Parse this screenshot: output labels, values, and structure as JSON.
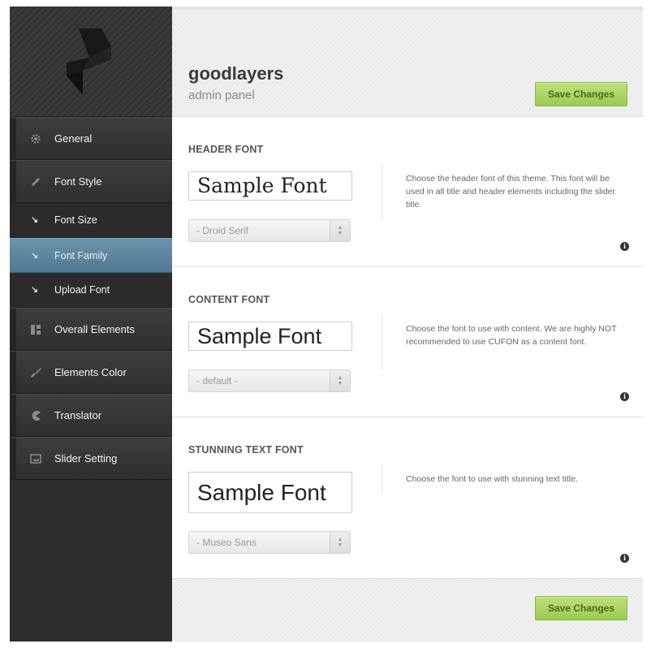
{
  "brand": {
    "title": "goodlayers",
    "subtitle": "admin panel"
  },
  "header": {
    "save_label": "Save Changes"
  },
  "footer": {
    "save_label": "Save Changes"
  },
  "sidebar": {
    "items": [
      {
        "label": "General",
        "icon": "gear-icon"
      },
      {
        "label": "Font Style",
        "icon": "pencil-icon"
      },
      {
        "label": "Font Size",
        "icon": "arrow-down-right-icon",
        "sub": true
      },
      {
        "label": "Font Family",
        "icon": "arrow-down-right-icon",
        "sub": true,
        "active": true
      },
      {
        "label": "Upload Font",
        "icon": "arrow-down-right-icon",
        "sub": true
      },
      {
        "label": "Overall Elements",
        "icon": "layout-icon"
      },
      {
        "label": "Elements Color",
        "icon": "brush-icon"
      },
      {
        "label": "Translator",
        "icon": "pacman-icon"
      },
      {
        "label": "Slider Setting",
        "icon": "image-icon"
      }
    ]
  },
  "sections": [
    {
      "title": "HEADER FONT",
      "sample": "Sample Font",
      "select_value": "- Droid Serif",
      "description": "Choose the header font of this theme. This font will be used in all title and header elements including the slider title."
    },
    {
      "title": "CONTENT FONT",
      "sample": "Sample Font",
      "select_value": "- default -",
      "description": "Choose the font to use with content. We are highly NOT recommended to use CUFON as a content font."
    },
    {
      "title": "STUNNING TEXT FONT",
      "sample": "Sample Font",
      "select_value": "- Museo Sans",
      "description": "Choose the font to use with stunning text title."
    }
  ],
  "colors": {
    "sidebar_bg": "#2d2d2d",
    "active_item": "#5f89a3",
    "save_button": "#a9d45e",
    "save_button_text": "#4b6a1c"
  }
}
